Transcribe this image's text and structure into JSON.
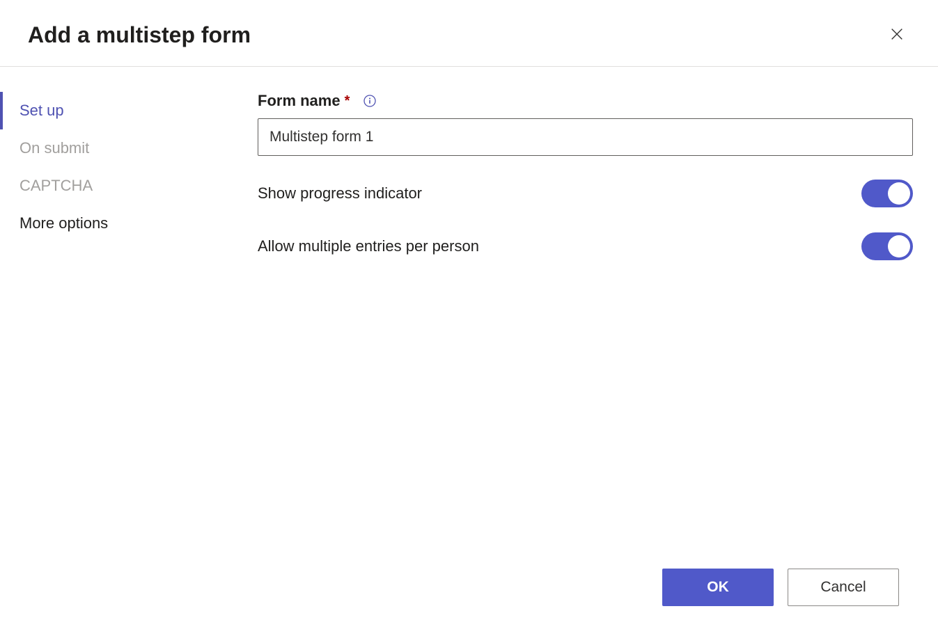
{
  "header": {
    "title": "Add a multistep form"
  },
  "sidebar": {
    "items": [
      {
        "label": "Set up",
        "active": true,
        "muted": false
      },
      {
        "label": "On submit",
        "active": false,
        "muted": true
      },
      {
        "label": "CAPTCHA",
        "active": false,
        "muted": true
      },
      {
        "label": "More options",
        "active": false,
        "muted": false
      }
    ]
  },
  "form": {
    "formNameLabel": "Form name",
    "formNameValue": "Multistep form 1",
    "showProgressLabel": "Show progress indicator",
    "showProgressOn": true,
    "allowMultipleLabel": "Allow multiple entries per person",
    "allowMultipleOn": true
  },
  "footer": {
    "okLabel": "OK",
    "cancelLabel": "Cancel"
  }
}
